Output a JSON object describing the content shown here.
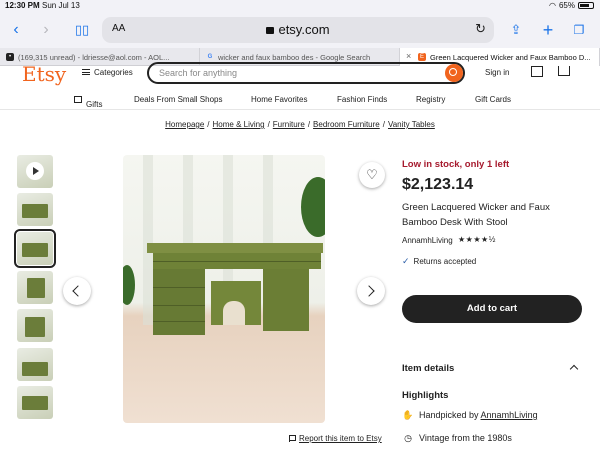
{
  "status_bar": {
    "time": "12:30 PM",
    "date": "Sun Jul 13",
    "battery": "65%"
  },
  "browser": {
    "text_size_label": "AA",
    "url": "etsy.com",
    "tabs": [
      {
        "label": "(169,315 unread) - ldriesse@aol.com - AOL...",
        "favicon": "aol"
      },
      {
        "label": "wicker and faux bamboo des - Google Search",
        "favicon": "G"
      },
      {
        "label": "Green Lacquered Wicker and Faux Bamboo D...",
        "favicon": "E",
        "active": true
      }
    ]
  },
  "etsy_header": {
    "logo": "Etsy",
    "categories_label": "Categories",
    "search_placeholder": "Search for anything",
    "sign_in_label": "Sign in"
  },
  "nav": {
    "items": [
      "Gifts",
      "Deals From Small Shops",
      "Home Favorites",
      "Fashion Finds",
      "Registry",
      "Gift Cards"
    ]
  },
  "breadcrumb": [
    "Homepage",
    "Home & Living",
    "Furniture",
    "Bedroom Furniture",
    "Vanity Tables"
  ],
  "product": {
    "stock_notice": "Low in stock, only 1 left",
    "price": "$2,123.14",
    "title": "Green Lacquered Wicker and Faux Bamboo Desk With Stool",
    "shop_name": "AnnamhLiving",
    "rating": 4.5,
    "stars_display": "★★★★½",
    "returns": "Returns accepted",
    "add_to_cart_label": "Add to cart",
    "item_details_label": "Item details",
    "highlights_label": "Highlights",
    "highlight_1_prefix": "Handpicked by ",
    "highlight_1_shop": "AnnamhLiving",
    "highlight_2": "Vintage from the 1980s"
  },
  "report_link": "Report this item to Etsy",
  "colors": {
    "etsy_orange": "#f1641e",
    "stock_red": "#a61a2e",
    "link_blue": "#1a73e8"
  }
}
